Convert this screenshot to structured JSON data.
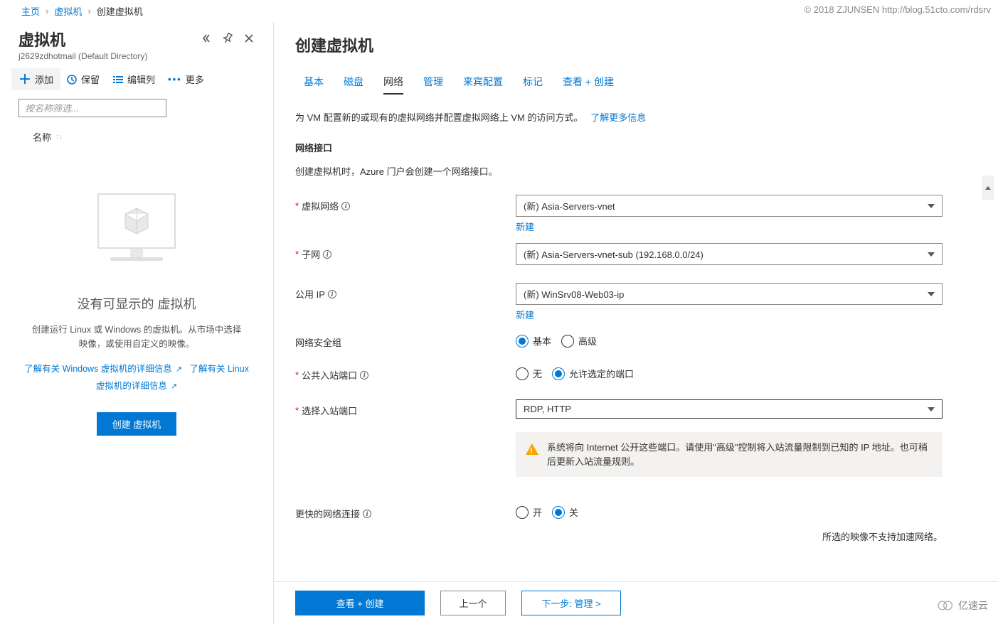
{
  "watermark_top": "© 2018 ZJUNSEN http://blog.51cto.com/rdsrv",
  "watermark_bottom": "亿速云",
  "breadcrumb": {
    "items": [
      "主页",
      "虚拟机",
      "创建虚拟机"
    ]
  },
  "left": {
    "title": "虚拟机",
    "subtitle": "j2629zdhotmail (Default Directory)",
    "toolbar": {
      "add": "添加",
      "keep": "保留",
      "edit_col": "编辑列",
      "more": "更多"
    },
    "filter_placeholder": "按名称筛选...",
    "list_header": "名称",
    "empty": {
      "title": "没有可显示的 虚拟机",
      "desc": "创建运行 Linux 或 Windows 的虚拟机。从市场中选择映像，或使用自定义的映像。",
      "link1": "了解有关 Windows 虚拟机的详细信息",
      "link2": "了解有关 Linux 虚拟机的详细信息",
      "create_btn": "创建 虚拟机"
    }
  },
  "right": {
    "title": "创建虚拟机",
    "tabs": [
      "基本",
      "磁盘",
      "网络",
      "管理",
      "来宾配置",
      "标记",
      "查看 + 创建"
    ],
    "active_tab": 2,
    "desc_prefix": "为 VM 配置新的或现有的虚拟网络并配置虚拟网络上 VM 的访问方式。",
    "desc_link": "了解更多信息",
    "section_h": "网络接口",
    "section_sub": "创建虚拟机时，Azure 门户会创建一个网络接口。",
    "fields": {
      "vnet": {
        "label": "虚拟网络",
        "value": "(新) Asia-Servers-vnet",
        "sublink": "新建"
      },
      "subnet": {
        "label": "子网",
        "value": "(新) Asia-Servers-vnet-sub (192.168.0.0/24)"
      },
      "pubip": {
        "label": "公用 IP",
        "value": "(新) WinSrv08-Web03-ip",
        "sublink": "新建"
      },
      "nsg": {
        "label": "网络安全组",
        "options": [
          "基本",
          "高级"
        ],
        "selected": 0
      },
      "pub_ports": {
        "label": "公共入站端口",
        "options": [
          "无",
          "允许选定的端口"
        ],
        "selected": 1
      },
      "sel_ports": {
        "label": "选择入站端口",
        "value": "RDP, HTTP"
      },
      "accel_net": {
        "label": "更快的网络连接",
        "options": [
          "开",
          "关"
        ],
        "selected": 1
      }
    },
    "warning": "系统将向 Internet 公开这些端口。请使用\"高级\"控制将入站流量限制到已知的 IP 地址。也可稍后更新入站流量规则。",
    "note": "所选的映像不支持加速网络。",
    "footer": {
      "review": "查看 + 创建",
      "prev": "上一个",
      "next": "下一步: 管理 >"
    }
  }
}
